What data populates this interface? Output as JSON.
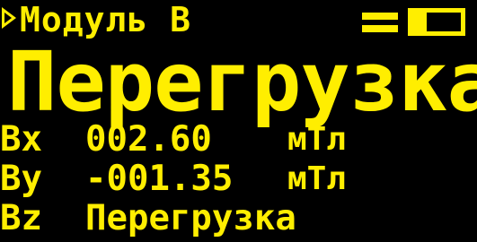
{
  "header": {
    "module_title": "Модуль В",
    "mode_icon": "play-triangle",
    "battery_level": 0.3
  },
  "status": {
    "main_text": "Перегрузка"
  },
  "readings": {
    "bx": {
      "label": "Bx",
      "value": "002.60",
      "unit": "мТл"
    },
    "by": {
      "label": "By",
      "value": "-001.35",
      "unit": "мТл"
    },
    "bz": {
      "label": "Bz",
      "value": "Перегрузка"
    }
  },
  "colors": {
    "foreground": "#ffee00",
    "background": "#000000"
  }
}
